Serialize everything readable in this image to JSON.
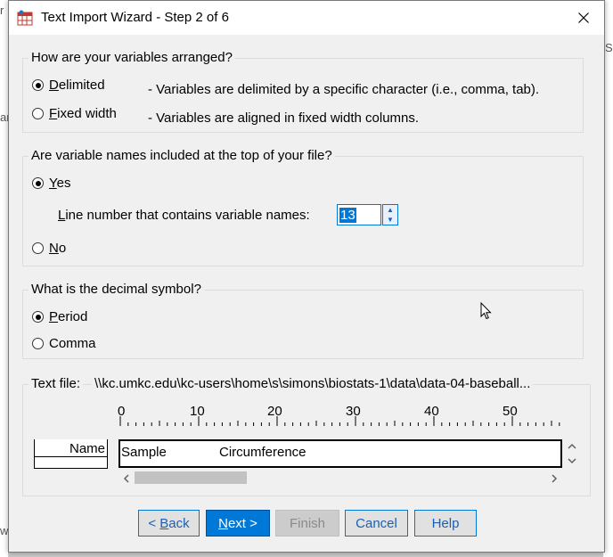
{
  "window": {
    "title": "Text Import Wizard - Step 2 of 6"
  },
  "arrangement": {
    "question": "How are your variables arranged?",
    "options": [
      {
        "label_first": "D",
        "label_rest": "elimited",
        "description": "- Variables are delimited by a specific character (i.e., comma, tab).",
        "checked": true
      },
      {
        "label_first": "F",
        "label_rest": "ixed width",
        "description": "- Variables are aligned in fixed width columns.",
        "checked": false
      }
    ]
  },
  "names": {
    "question": "Are variable names included at the top of your file?",
    "yes_first": "Y",
    "yes_rest": "es",
    "line_label_first": "L",
    "line_label_rest": "ine number that contains variable names:",
    "line_value": "13",
    "no_first": "N",
    "no_rest": "o"
  },
  "decimal": {
    "question": "What is the decimal symbol?",
    "period_first": "P",
    "period_rest": "eriod",
    "comma_label": "Comma"
  },
  "preview": {
    "label": "Text file:",
    "path": "\\\\kc.umkc.edu\\kc-users\\home\\s\\simons\\biostats-1\\data\\data-04-baseball...",
    "ruler": [
      "0",
      "10",
      "20",
      "30",
      "40",
      "50"
    ],
    "row_header": "Name",
    "row_cells": [
      "Sample",
      "Circumference"
    ]
  },
  "buttons": {
    "back_prefix": "< ",
    "back_first": "B",
    "back_rest": "ack",
    "next_first": "N",
    "next_rest": "ext >",
    "finish": "Finish",
    "cancel": "Cancel",
    "help": "Help"
  },
  "background": {
    "left_chars": [
      "r",
      "ar",
      "w"
    ],
    "right_chars": [
      "S"
    ]
  }
}
